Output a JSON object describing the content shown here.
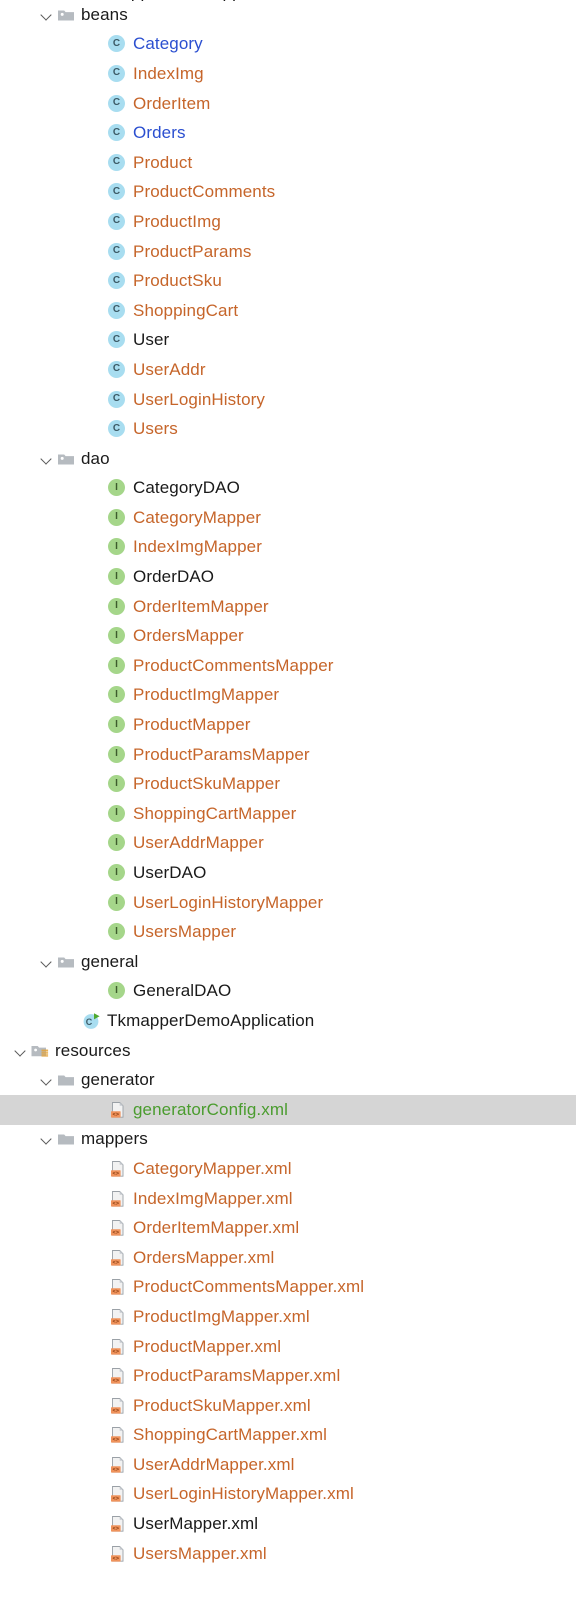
{
  "colors": {
    "generated_orange": "#c6652a",
    "normal_black": "#1a1a1a",
    "class_blue": "#2b4fd0",
    "selected_green": "#4a9c2e",
    "selection_bg": "#d5d5d5",
    "class_badge_bg": "#a8ddf0",
    "interface_badge_bg": "#a5d68a",
    "folder_grey": "#b6bbc0",
    "xml_badge_orange": "#f0935c"
  },
  "icon_glyphs": {
    "class": "C",
    "interface": "I"
  },
  "selected_item": "generatorConfig.xml",
  "clipped_top_row": {
    "label": "TkmapperDemoApplication",
    "note": "partially cut off above viewport"
  },
  "tree": [
    {
      "label": "beans",
      "icon": "folder-icon",
      "depth": 2,
      "twisty": "open",
      "color": "c-black"
    },
    {
      "label": "Category",
      "icon": "class-icon",
      "depth": 4,
      "twisty": "none",
      "color": "c-blue"
    },
    {
      "label": "IndexImg",
      "icon": "class-icon",
      "depth": 4,
      "twisty": "none",
      "color": "c-orange"
    },
    {
      "label": "OrderItem",
      "icon": "class-icon",
      "depth": 4,
      "twisty": "none",
      "color": "c-orange"
    },
    {
      "label": "Orders",
      "icon": "class-icon",
      "depth": 4,
      "twisty": "none",
      "color": "c-blue"
    },
    {
      "label": "Product",
      "icon": "class-icon",
      "depth": 4,
      "twisty": "none",
      "color": "c-orange"
    },
    {
      "label": "ProductComments",
      "icon": "class-icon",
      "depth": 4,
      "twisty": "none",
      "color": "c-orange"
    },
    {
      "label": "ProductImg",
      "icon": "class-icon",
      "depth": 4,
      "twisty": "none",
      "color": "c-orange"
    },
    {
      "label": "ProductParams",
      "icon": "class-icon",
      "depth": 4,
      "twisty": "none",
      "color": "c-orange"
    },
    {
      "label": "ProductSku",
      "icon": "class-icon",
      "depth": 4,
      "twisty": "none",
      "color": "c-orange"
    },
    {
      "label": "ShoppingCart",
      "icon": "class-icon",
      "depth": 4,
      "twisty": "none",
      "color": "c-orange"
    },
    {
      "label": "User",
      "icon": "class-icon",
      "depth": 4,
      "twisty": "none",
      "color": "c-black"
    },
    {
      "label": "UserAddr",
      "icon": "class-icon",
      "depth": 4,
      "twisty": "none",
      "color": "c-orange"
    },
    {
      "label": "UserLoginHistory",
      "icon": "class-icon",
      "depth": 4,
      "twisty": "none",
      "color": "c-orange"
    },
    {
      "label": "Users",
      "icon": "class-icon",
      "depth": 4,
      "twisty": "none",
      "color": "c-orange"
    },
    {
      "label": "dao",
      "icon": "folder-icon",
      "depth": 2,
      "twisty": "open",
      "color": "c-black"
    },
    {
      "label": "CategoryDAO",
      "icon": "interface-icon",
      "depth": 4,
      "twisty": "none",
      "color": "c-black"
    },
    {
      "label": "CategoryMapper",
      "icon": "interface-icon",
      "depth": 4,
      "twisty": "none",
      "color": "c-orange"
    },
    {
      "label": "IndexImgMapper",
      "icon": "interface-icon",
      "depth": 4,
      "twisty": "none",
      "color": "c-orange"
    },
    {
      "label": "OrderDAO",
      "icon": "interface-icon",
      "depth": 4,
      "twisty": "none",
      "color": "c-black"
    },
    {
      "label": "OrderItemMapper",
      "icon": "interface-icon",
      "depth": 4,
      "twisty": "none",
      "color": "c-orange"
    },
    {
      "label": "OrdersMapper",
      "icon": "interface-icon",
      "depth": 4,
      "twisty": "none",
      "color": "c-orange"
    },
    {
      "label": "ProductCommentsMapper",
      "icon": "interface-icon",
      "depth": 4,
      "twisty": "none",
      "color": "c-orange"
    },
    {
      "label": "ProductImgMapper",
      "icon": "interface-icon",
      "depth": 4,
      "twisty": "none",
      "color": "c-orange"
    },
    {
      "label": "ProductMapper",
      "icon": "interface-icon",
      "depth": 4,
      "twisty": "none",
      "color": "c-orange"
    },
    {
      "label": "ProductParamsMapper",
      "icon": "interface-icon",
      "depth": 4,
      "twisty": "none",
      "color": "c-orange"
    },
    {
      "label": "ProductSkuMapper",
      "icon": "interface-icon",
      "depth": 4,
      "twisty": "none",
      "color": "c-orange"
    },
    {
      "label": "ShoppingCartMapper",
      "icon": "interface-icon",
      "depth": 4,
      "twisty": "none",
      "color": "c-orange"
    },
    {
      "label": "UserAddrMapper",
      "icon": "interface-icon",
      "depth": 4,
      "twisty": "none",
      "color": "c-orange"
    },
    {
      "label": "UserDAO",
      "icon": "interface-icon",
      "depth": 4,
      "twisty": "none",
      "color": "c-black"
    },
    {
      "label": "UserLoginHistoryMapper",
      "icon": "interface-icon",
      "depth": 4,
      "twisty": "none",
      "color": "c-orange"
    },
    {
      "label": "UsersMapper",
      "icon": "interface-icon",
      "depth": 4,
      "twisty": "none",
      "color": "c-orange"
    },
    {
      "label": "general",
      "icon": "folder-icon",
      "depth": 2,
      "twisty": "open",
      "color": "c-black"
    },
    {
      "label": "GeneralDAO",
      "icon": "interface-icon",
      "depth": 4,
      "twisty": "none",
      "color": "c-black"
    },
    {
      "label": "TkmapperDemoApplication",
      "icon": "runnable-class-icon",
      "depth": 3,
      "twisty": "none",
      "color": "c-black"
    },
    {
      "label": "resources",
      "icon": "resources-folder-icon",
      "depth": 1,
      "twisty": "open",
      "color": "c-black"
    },
    {
      "label": "generator",
      "icon": "folder-plain-icon",
      "depth": 2,
      "twisty": "open",
      "color": "c-black"
    },
    {
      "label": "generatorConfig.xml",
      "icon": "xml-file-icon",
      "depth": 4,
      "twisty": "none",
      "color": "c-green",
      "selected": true
    },
    {
      "label": "mappers",
      "icon": "folder-plain-icon",
      "depth": 2,
      "twisty": "open",
      "color": "c-black"
    },
    {
      "label": "CategoryMapper.xml",
      "icon": "xml-file-icon",
      "depth": 4,
      "twisty": "none",
      "color": "c-orange"
    },
    {
      "label": "IndexImgMapper.xml",
      "icon": "xml-file-icon",
      "depth": 4,
      "twisty": "none",
      "color": "c-orange"
    },
    {
      "label": "OrderItemMapper.xml",
      "icon": "xml-file-icon",
      "depth": 4,
      "twisty": "none",
      "color": "c-orange"
    },
    {
      "label": "OrdersMapper.xml",
      "icon": "xml-file-icon",
      "depth": 4,
      "twisty": "none",
      "color": "c-orange"
    },
    {
      "label": "ProductCommentsMapper.xml",
      "icon": "xml-file-icon",
      "depth": 4,
      "twisty": "none",
      "color": "c-orange"
    },
    {
      "label": "ProductImgMapper.xml",
      "icon": "xml-file-icon",
      "depth": 4,
      "twisty": "none",
      "color": "c-orange"
    },
    {
      "label": "ProductMapper.xml",
      "icon": "xml-file-icon",
      "depth": 4,
      "twisty": "none",
      "color": "c-orange"
    },
    {
      "label": "ProductParamsMapper.xml",
      "icon": "xml-file-icon",
      "depth": 4,
      "twisty": "none",
      "color": "c-orange"
    },
    {
      "label": "ProductSkuMapper.xml",
      "icon": "xml-file-icon",
      "depth": 4,
      "twisty": "none",
      "color": "c-orange"
    },
    {
      "label": "ShoppingCartMapper.xml",
      "icon": "xml-file-icon",
      "depth": 4,
      "twisty": "none",
      "color": "c-orange"
    },
    {
      "label": "UserAddrMapper.xml",
      "icon": "xml-file-icon",
      "depth": 4,
      "twisty": "none",
      "color": "c-orange"
    },
    {
      "label": "UserLoginHistoryMapper.xml",
      "icon": "xml-file-icon",
      "depth": 4,
      "twisty": "none",
      "color": "c-orange"
    },
    {
      "label": "UserMapper.xml",
      "icon": "xml-file-icon",
      "depth": 4,
      "twisty": "none",
      "color": "c-black"
    },
    {
      "label": "UsersMapper.xml",
      "icon": "xml-file-icon",
      "depth": 4,
      "twisty": "none",
      "color": "c-orange"
    }
  ]
}
